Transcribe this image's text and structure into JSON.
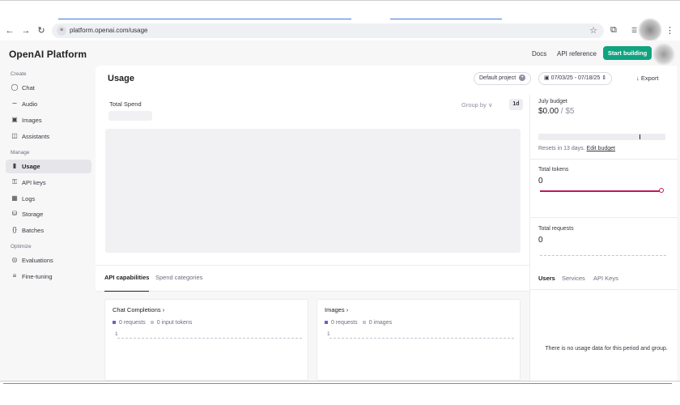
{
  "browser": {
    "url": "platform.openai.com/usage",
    "back_icon": "arrow-left",
    "forward_icon": "arrow-right",
    "reload_icon": "reload"
  },
  "header": {
    "brand": "OpenAI  Platform",
    "docs": "Docs",
    "api_reference": "API reference",
    "start_building": "Start building",
    "accent": "#10a37f"
  },
  "sidebar": {
    "sections": {
      "create": "Create",
      "manage": "Manage",
      "optimize": "Optimize"
    },
    "items": [
      {
        "label": "Chat",
        "icon": "chat-bubble"
      },
      {
        "label": "Audio",
        "icon": "waveform"
      },
      {
        "label": "Images",
        "icon": "image"
      },
      {
        "label": "Assistants",
        "icon": "robot"
      },
      {
        "label": "Usage",
        "icon": "bar-chart",
        "active": true
      },
      {
        "label": "API keys",
        "icon": "key"
      },
      {
        "label": "Logs",
        "icon": "terminal"
      },
      {
        "label": "Storage",
        "icon": "database"
      },
      {
        "label": "Batches",
        "icon": "braces"
      },
      {
        "label": "Evaluations",
        "icon": "target"
      },
      {
        "label": "Fine-tuning",
        "icon": "sliders"
      }
    ]
  },
  "main": {
    "title": "Usage",
    "project": "Default project",
    "date_range": "07/03/25 - 07/18/25",
    "export": "Export",
    "total_spend": "Total Spend",
    "group_by": "Group by",
    "period": "1d",
    "tabs": [
      "API capabilities",
      "Spend categories"
    ],
    "cards": [
      {
        "title": "Chat Completions",
        "legend_a": "0 requests",
        "legend_b": "0 input tokens",
        "y_tick": "1"
      },
      {
        "title": "Images",
        "legend_a": "0 requests",
        "legend_b": "0 images",
        "y_tick": "1"
      }
    ]
  },
  "right_panel": {
    "budget_label": "July budget",
    "budget_spent": "$0.00",
    "budget_sep": " / ",
    "budget_limit": "$5",
    "budget_used_fraction": 0,
    "resets_text": "Resets in 13 days.",
    "edit_budget": "Edit budget",
    "tokens_label": "Total tokens",
    "tokens_value": "0",
    "requests_label": "Total requests",
    "requests_value": "0",
    "tabs": [
      "Users",
      "Services",
      "API Keys"
    ],
    "no_data": "There is no usage data for this period and group."
  }
}
